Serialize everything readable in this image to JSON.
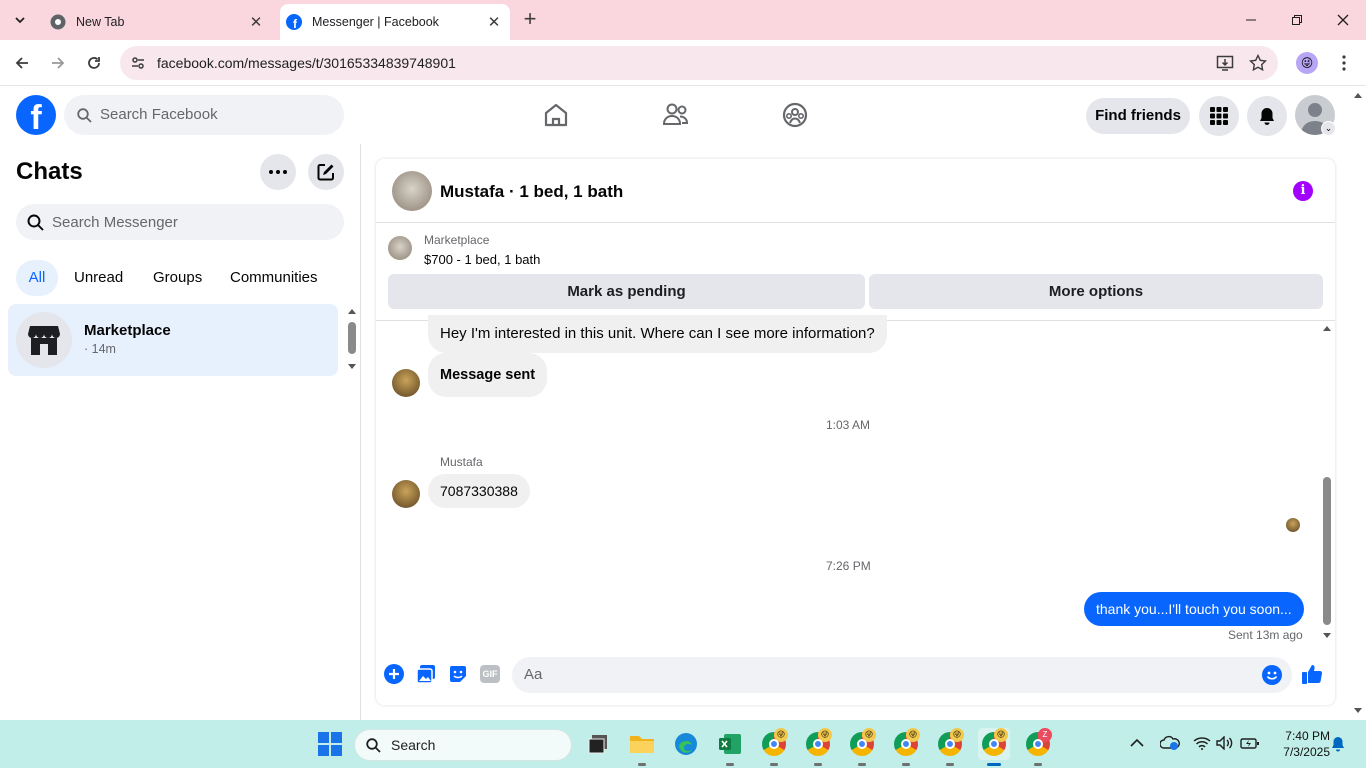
{
  "browser": {
    "tabs": [
      {
        "title": "New Tab",
        "active": false
      },
      {
        "title": "Messenger | Facebook",
        "active": true
      }
    ],
    "url": "facebook.com/messages/t/30165334839748901"
  },
  "facebook": {
    "search_placeholder": "Search Facebook",
    "find_friends_label": "Find friends"
  },
  "sidebar": {
    "title": "Chats",
    "search_placeholder": "Search Messenger",
    "filters": [
      "All",
      "Unread",
      "Groups",
      "Communities"
    ],
    "chats": [
      {
        "name": "Marketplace",
        "time": "· 14m"
      }
    ]
  },
  "conversation": {
    "title": "Mustafa · 1 bed, 1 bath",
    "marketplace_label": "Marketplace",
    "listing": "$700 - 1 bed, 1 bath",
    "mark_pending_label": "Mark as pending",
    "more_options_label": "More options",
    "messages": {
      "m1": "Hey I'm interested in this unit.  Where can I see more information?",
      "m2": "Message sent",
      "time1": "1:03 AM",
      "sender": "Mustafa",
      "m3": "7087330388",
      "time2": "7:26 PM",
      "m4": "thank you...I'll touch you soon...",
      "status": "Sent 13m ago"
    },
    "composer_placeholder": "Aa",
    "gif_label": "GIF"
  },
  "taskbar": {
    "search_label": "Search",
    "time": "7:40 PM",
    "date": "7/3/2025"
  },
  "colors": {
    "facebook_blue": "#0866ff",
    "info_purple": "#a200ff",
    "tabstrip_pink": "#fad7df",
    "taskbar_teal": "#c1eee8"
  }
}
